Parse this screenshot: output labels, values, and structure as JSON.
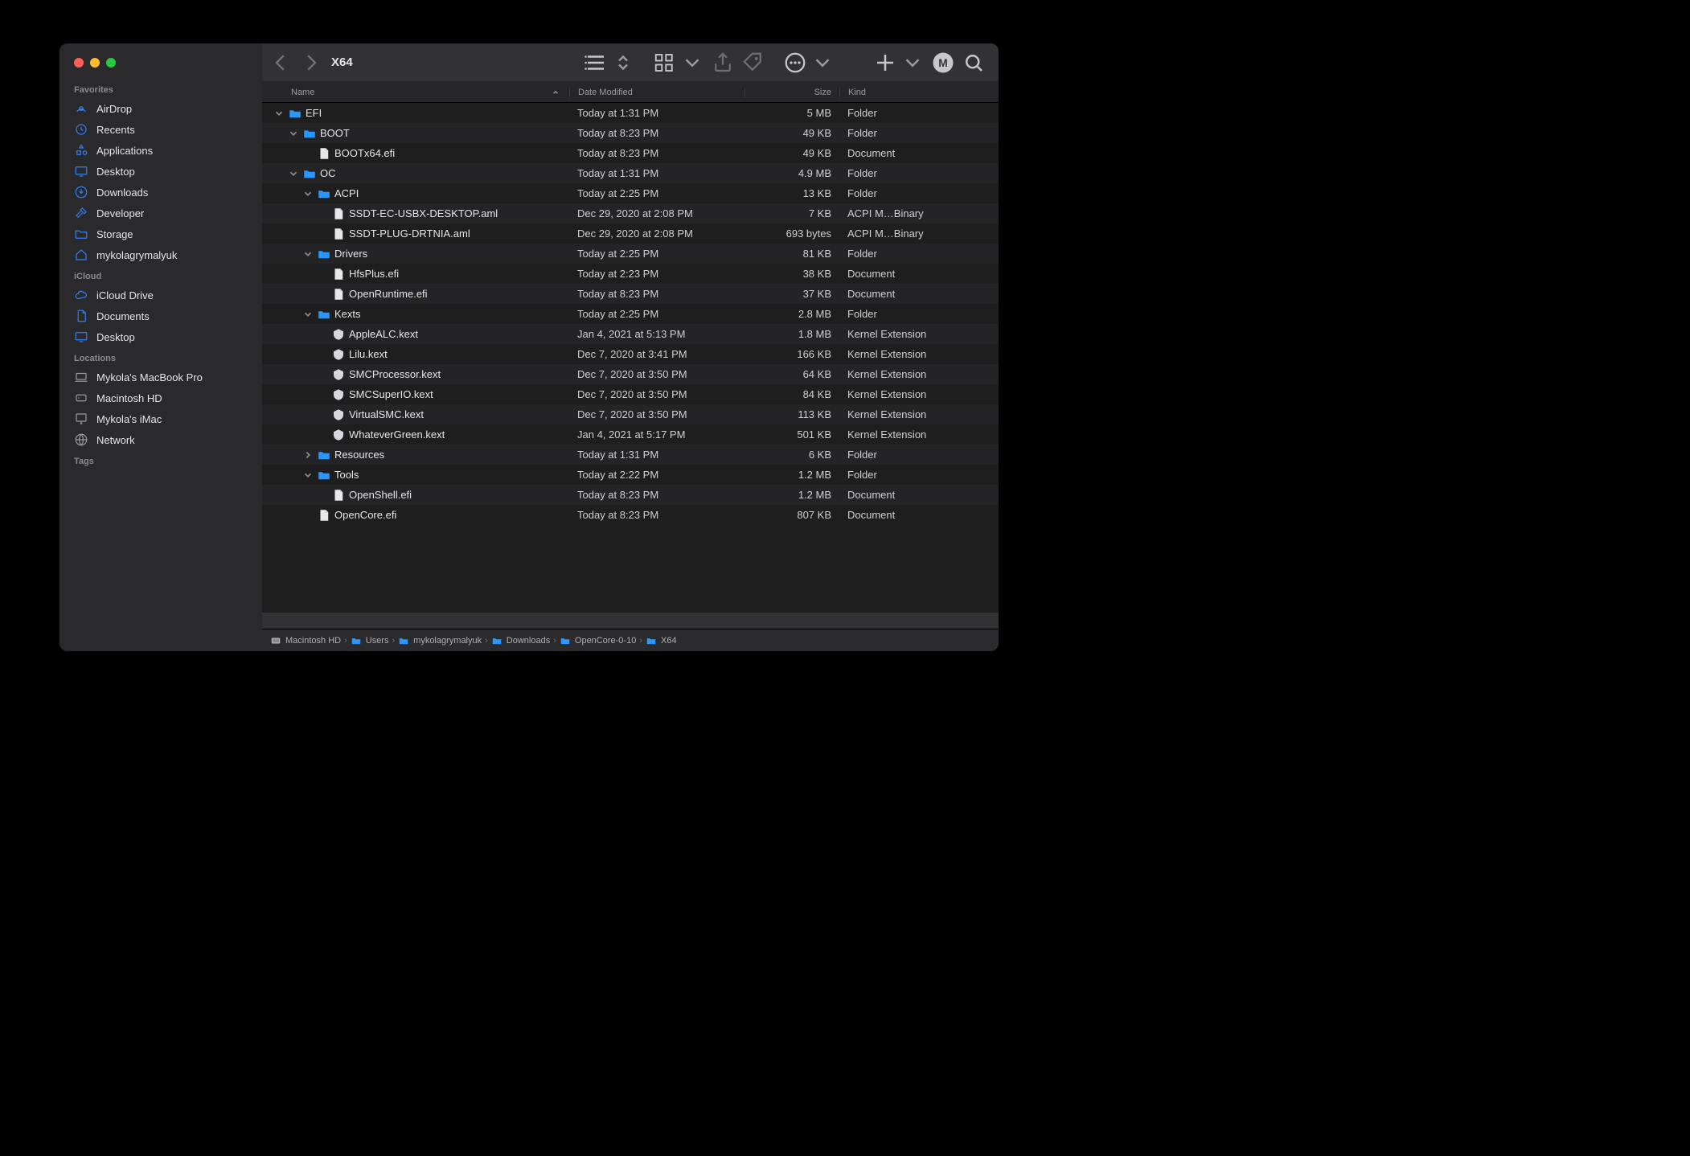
{
  "window_title": "X64",
  "sidebar": {
    "sections": [
      {
        "label": "Favorites",
        "items": [
          {
            "icon": "airdrop",
            "label": "AirDrop"
          },
          {
            "icon": "clock",
            "label": "Recents"
          },
          {
            "icon": "apps",
            "label": "Applications"
          },
          {
            "icon": "desktop",
            "label": "Desktop"
          },
          {
            "icon": "download",
            "label": "Downloads"
          },
          {
            "icon": "hammer",
            "label": "Developer"
          },
          {
            "icon": "folder",
            "label": "Storage"
          },
          {
            "icon": "home",
            "label": "mykolagrymalyuk"
          }
        ]
      },
      {
        "label": "iCloud",
        "items": [
          {
            "icon": "cloud",
            "label": "iCloud Drive"
          },
          {
            "icon": "doc",
            "label": "Documents"
          },
          {
            "icon": "desktop",
            "label": "Desktop"
          }
        ]
      },
      {
        "label": "Locations",
        "items": [
          {
            "icon": "laptop",
            "label": "Mykola's MacBook Pro",
            "gray": true
          },
          {
            "icon": "disk",
            "label": "Macintosh HD",
            "gray": true
          },
          {
            "icon": "imac",
            "label": "Mykola's iMac",
            "gray": true
          },
          {
            "icon": "globe",
            "label": "Network",
            "gray": true
          }
        ]
      },
      {
        "label": "Tags",
        "items": []
      }
    ]
  },
  "columns": {
    "name": "Name",
    "date": "Date Modified",
    "size": "Size",
    "kind": "Kind"
  },
  "rows": [
    {
      "depth": 0,
      "disclosure": "down",
      "icon": "folder",
      "name": "EFI",
      "date": "Today at 1:31 PM",
      "size": "5 MB",
      "kind": "Folder"
    },
    {
      "depth": 1,
      "disclosure": "down",
      "icon": "folder",
      "name": "BOOT",
      "date": "Today at 8:23 PM",
      "size": "49 KB",
      "kind": "Folder"
    },
    {
      "depth": 2,
      "disclosure": "",
      "icon": "file",
      "name": "BOOTx64.efi",
      "date": "Today at 8:23 PM",
      "size": "49 KB",
      "kind": "Document"
    },
    {
      "depth": 1,
      "disclosure": "down",
      "icon": "folder",
      "name": "OC",
      "date": "Today at 1:31 PM",
      "size": "4.9 MB",
      "kind": "Folder"
    },
    {
      "depth": 2,
      "disclosure": "down",
      "icon": "folder",
      "name": "ACPI",
      "date": "Today at 2:25 PM",
      "size": "13 KB",
      "kind": "Folder"
    },
    {
      "depth": 3,
      "disclosure": "",
      "icon": "file",
      "name": "SSDT-EC-USBX-DESKTOP.aml",
      "date": "Dec 29, 2020 at 2:08 PM",
      "size": "7 KB",
      "kind": "ACPI M…Binary"
    },
    {
      "depth": 3,
      "disclosure": "",
      "icon": "file",
      "name": "SSDT-PLUG-DRTNIA.aml",
      "date": "Dec 29, 2020 at 2:08 PM",
      "size": "693 bytes",
      "kind": "ACPI M…Binary"
    },
    {
      "depth": 2,
      "disclosure": "down",
      "icon": "folder",
      "name": "Drivers",
      "date": "Today at 2:25 PM",
      "size": "81 KB",
      "kind": "Folder"
    },
    {
      "depth": 3,
      "disclosure": "",
      "icon": "file",
      "name": "HfsPlus.efi",
      "date": "Today at 2:23 PM",
      "size": "38 KB",
      "kind": "Document"
    },
    {
      "depth": 3,
      "disclosure": "",
      "icon": "file",
      "name": "OpenRuntime.efi",
      "date": "Today at 8:23 PM",
      "size": "37 KB",
      "kind": "Document"
    },
    {
      "depth": 2,
      "disclosure": "down",
      "icon": "folder",
      "name": "Kexts",
      "date": "Today at 2:25 PM",
      "size": "2.8 MB",
      "kind": "Folder"
    },
    {
      "depth": 3,
      "disclosure": "",
      "icon": "kext",
      "name": "AppleALC.kext",
      "date": "Jan 4, 2021 at 5:13 PM",
      "size": "1.8 MB",
      "kind": "Kernel Extension"
    },
    {
      "depth": 3,
      "disclosure": "",
      "icon": "kext",
      "name": "Lilu.kext",
      "date": "Dec 7, 2020 at 3:41 PM",
      "size": "166 KB",
      "kind": "Kernel Extension"
    },
    {
      "depth": 3,
      "disclosure": "",
      "icon": "kext",
      "name": "SMCProcessor.kext",
      "date": "Dec 7, 2020 at 3:50 PM",
      "size": "64 KB",
      "kind": "Kernel Extension"
    },
    {
      "depth": 3,
      "disclosure": "",
      "icon": "kext",
      "name": "SMCSuperIO.kext",
      "date": "Dec 7, 2020 at 3:50 PM",
      "size": "84 KB",
      "kind": "Kernel Extension"
    },
    {
      "depth": 3,
      "disclosure": "",
      "icon": "kext",
      "name": "VirtualSMC.kext",
      "date": "Dec 7, 2020 at 3:50 PM",
      "size": "113 KB",
      "kind": "Kernel Extension"
    },
    {
      "depth": 3,
      "disclosure": "",
      "icon": "kext",
      "name": "WhateverGreen.kext",
      "date": "Jan 4, 2021 at 5:17 PM",
      "size": "501 KB",
      "kind": "Kernel Extension"
    },
    {
      "depth": 2,
      "disclosure": "right",
      "icon": "folder",
      "name": "Resources",
      "date": "Today at 1:31 PM",
      "size": "6 KB",
      "kind": "Folder"
    },
    {
      "depth": 2,
      "disclosure": "down",
      "icon": "folder",
      "name": "Tools",
      "date": "Today at 2:22 PM",
      "size": "1.2 MB",
      "kind": "Folder"
    },
    {
      "depth": 3,
      "disclosure": "",
      "icon": "file",
      "name": "OpenShell.efi",
      "date": "Today at 8:23 PM",
      "size": "1.2 MB",
      "kind": "Document"
    },
    {
      "depth": 2,
      "disclosure": "",
      "icon": "file",
      "name": "OpenCore.efi",
      "date": "Today at 8:23 PM",
      "size": "807 KB",
      "kind": "Document"
    }
  ],
  "pathbar": [
    {
      "icon": "disk",
      "label": "Macintosh HD"
    },
    {
      "icon": "folder",
      "label": "Users"
    },
    {
      "icon": "folder",
      "label": "mykolagrymalyuk"
    },
    {
      "icon": "folder",
      "label": "Downloads"
    },
    {
      "icon": "folder",
      "label": "OpenCore-0-10"
    },
    {
      "icon": "folder",
      "label": "X64"
    }
  ]
}
